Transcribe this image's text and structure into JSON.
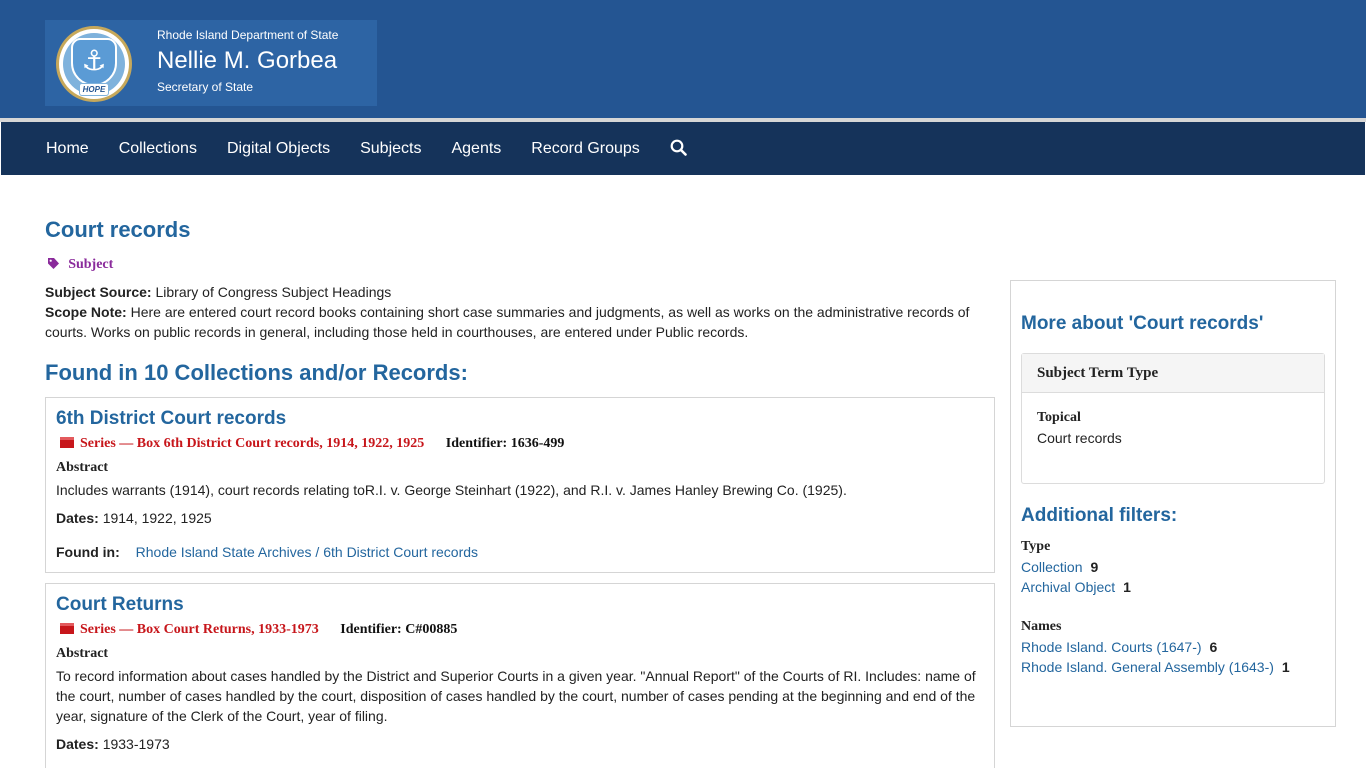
{
  "header": {
    "department": "Rhode Island Department of State",
    "name": "Nellie M. Gorbea",
    "role": "Secretary of State",
    "seal_text": "HOPE"
  },
  "nav": {
    "items": [
      {
        "label": "Home"
      },
      {
        "label": "Collections"
      },
      {
        "label": "Digital Objects"
      },
      {
        "label": "Subjects"
      },
      {
        "label": "Agents"
      },
      {
        "label": "Record Groups"
      }
    ],
    "search_icon": "search-icon"
  },
  "subject": {
    "title": "Court records",
    "badge": "Subject",
    "source_label": "Subject Source:",
    "source_value": "Library of Congress Subject Headings",
    "scope_label": "Scope Note:",
    "scope_value": "Here are entered court record books containing short case summaries and judgments, as well as works on the administrative records of courts. Works on public records in general, including those held in courthouses, are entered under Public records."
  },
  "results": {
    "heading": "Found in 10 Collections and/or Records:",
    "items": [
      {
        "title": "6th District Court records",
        "series": "Series — Box 6th District Court records, 1914, 1922, 1925",
        "identifier_label": "Identifier:",
        "identifier": "1636-499",
        "abstract_label": "Abstract",
        "abstract": "Includes warrants (1914), court records relating toR.I. v. George Steinhart (1922), and R.I. v. James Hanley Brewing Co. (1925).",
        "dates_label": "Dates:",
        "dates": "1914, 1922, 1925",
        "found_in_label": "Found in:",
        "found_in_1": "Rhode Island State Archives",
        "found_in_sep": " / ",
        "found_in_2": "6th District Court records"
      },
      {
        "title": "Court Returns",
        "series": "Series — Box Court Returns, 1933-1973",
        "identifier_label": "Identifier:",
        "identifier": "C#00885",
        "abstract_label": "Abstract",
        "abstract": "To record information about cases handled by the District and Superior Courts in a given year. \"Annual Report\" of the Courts of RI. Includes: name of the court, number of cases handled by the court, disposition of cases handled by the court, number of cases pending at the beginning and end of the year, signature of the Clerk of the Court, year of filing.",
        "dates_label": "Dates:",
        "dates": "1933-1973"
      }
    ]
  },
  "sidebar": {
    "more_heading": "More about 'Court records'",
    "term_type_heading": "Subject Term Type",
    "term_type_label": "Topical",
    "term_type_value": "Court records",
    "filters_heading": "Additional filters:",
    "type_heading": "Type",
    "type_items": [
      {
        "label": "Collection",
        "count": "9"
      },
      {
        "label": "Archival Object",
        "count": "1"
      }
    ],
    "names_heading": "Names",
    "names_items": [
      {
        "label": "Rhode Island. Courts (1647-)",
        "count": "6"
      },
      {
        "label": "Rhode Island. General Assembly (1643-)",
        "count": "1"
      }
    ]
  }
}
